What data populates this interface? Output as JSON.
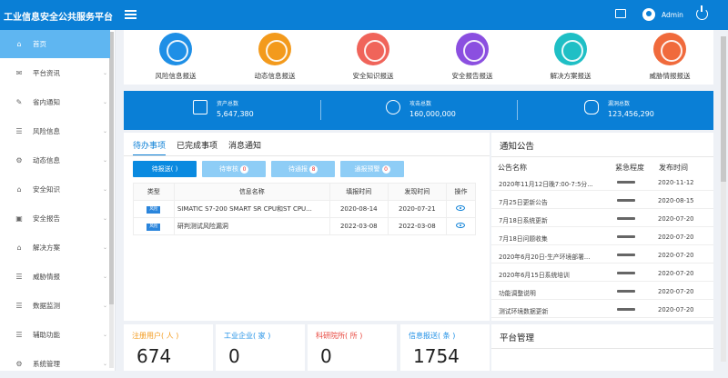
{
  "app": {
    "title": "工业信息安全公共服务平台",
    "user": "Admin"
  },
  "sidebar": {
    "items": [
      {
        "label": "首页",
        "icon": "home-icon",
        "glyph": "⌂"
      },
      {
        "label": "平台资讯",
        "icon": "mail-icon",
        "glyph": "✉"
      },
      {
        "label": "省内通知",
        "icon": "edit-icon",
        "glyph": "✎"
      },
      {
        "label": "风险信息",
        "icon": "list-icon",
        "glyph": "☰"
      },
      {
        "label": "动态信息",
        "icon": "gear-icon",
        "glyph": "⚙"
      },
      {
        "label": "安全知识",
        "icon": "bank-icon",
        "glyph": "⌂"
      },
      {
        "label": "安全报告",
        "icon": "report-icon",
        "glyph": "▣"
      },
      {
        "label": "解决方案",
        "icon": "bank-icon",
        "glyph": "⌂"
      },
      {
        "label": "威胁情报",
        "icon": "list-icon",
        "glyph": "☰"
      },
      {
        "label": "数据监测",
        "icon": "list-icon",
        "glyph": "☰"
      },
      {
        "label": "辅助功能",
        "icon": "list-icon",
        "glyph": "☰"
      },
      {
        "label": "系统管理",
        "icon": "settings-icon",
        "glyph": "⚙"
      }
    ]
  },
  "quick": {
    "items": [
      {
        "label": "风险信息报送",
        "color": "#1e8fe6"
      },
      {
        "label": "动态信息报送",
        "color": "#f39a1c"
      },
      {
        "label": "安全知识报送",
        "color": "#f0645a"
      },
      {
        "label": "安全报告报送",
        "color": "#8b4fe0"
      },
      {
        "label": "解决方案报送",
        "color": "#1fbfc5"
      },
      {
        "label": "威胁情报报送",
        "color": "#f06a3c"
      }
    ]
  },
  "stats": {
    "assets": {
      "label": "资产总数",
      "value": "5,647,380"
    },
    "attacks": {
      "label": "攻击总数",
      "value": "160,000,000"
    },
    "vulns": {
      "label": "漏洞总数",
      "value": "123,456,290"
    }
  },
  "tasks": {
    "tabs": [
      "待办事项",
      "已完成事项",
      "消息通知"
    ],
    "filters": [
      {
        "label": "待报送",
        "count": "( )"
      },
      {
        "label": "待审核",
        "count": "0"
      },
      {
        "label": "待通报",
        "count": "8"
      },
      {
        "label": "通报预警",
        "count": "0"
      }
    ],
    "columns": [
      "类型",
      "信息名称",
      "填报时间",
      "发现时间",
      "操作"
    ],
    "rows": [
      {
        "tag": "风险",
        "name": "SIMATIC S7-200 SMART SR CPU和ST CPU...",
        "filled": "2020-08-14",
        "found": "2020-07-21"
      },
      {
        "tag": "风险",
        "name": "研判测试风险漏洞",
        "filled": "2022-03-08",
        "found": "2022-03-08"
      }
    ]
  },
  "notices": {
    "title": "通知公告",
    "columns": [
      "公告名称",
      "紧急程度",
      "发布时间"
    ],
    "rows": [
      {
        "title": "2020年11月12日晚7:00-7:5分...",
        "date": "2020-11-12"
      },
      {
        "title": "7月25日更新公告",
        "date": "2020-08-15"
      },
      {
        "title": "7月18日系统更新",
        "date": "2020-07-20"
      },
      {
        "title": "7月18日问题收集",
        "date": "2020-07-20"
      },
      {
        "title": "2020年6月20日-生产环境部署...",
        "date": "2020-07-20"
      },
      {
        "title": "2020年6月15日系统培训",
        "date": "2020-07-20"
      },
      {
        "title": "功能调整说明",
        "date": "2020-07-20"
      },
      {
        "title": "测试环境数据更新",
        "date": "2020-07-20"
      }
    ]
  },
  "counters": [
    {
      "label": "注册用户( 人 )",
      "value": "674",
      "color": "#f39a1c"
    },
    {
      "label": "工业企业( 家 )",
      "value": "0",
      "color": "#1e8fe6"
    },
    {
      "label": "科研院所( 所 )",
      "value": "0",
      "color": "#e8453c"
    },
    {
      "label": "信息报送( 条 )",
      "value": "1754",
      "color": "#1e8fe6"
    }
  ],
  "platform": {
    "title": "平台管理"
  }
}
